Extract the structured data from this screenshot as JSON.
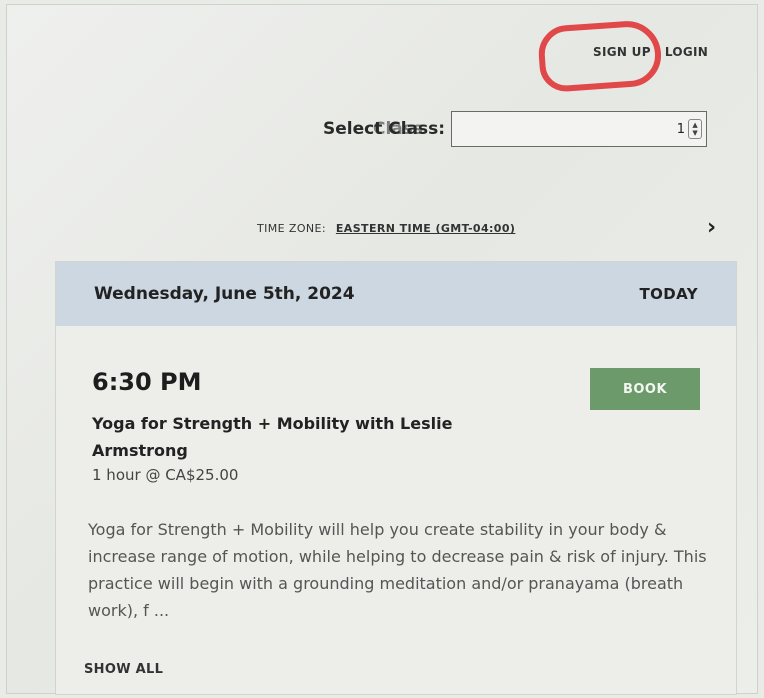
{
  "nav": {
    "signup_label": "SIGN UP",
    "login_label": "LOGIN"
  },
  "class_select": {
    "label": "Select Class:",
    "ghost_text": "Class",
    "value": "1"
  },
  "timezone": {
    "label": "TIME ZONE:",
    "value": "EASTERN TIME (GMT-04:00)",
    "next_icon": "chevron-right-icon"
  },
  "schedule": {
    "date": "Wednesday, June 5th, 2024",
    "today_label": "TODAY",
    "class": {
      "time": "6:30 PM",
      "book_label": "BOOK",
      "name": "Yoga for Strength + Mobility with Leslie Armstrong",
      "meta": "1 hour @ CA$25.00",
      "description": "Yoga for Strength + Mobility will help you create stability in your body & increase range of motion, while helping to decrease pain & risk of injury. This practice will begin with a grounding meditation and/or pranayama (breath work), f ..."
    },
    "show_all_label": "SHOW ALL"
  },
  "colors": {
    "book_button": "#6d9a6b",
    "day_header": "#cdd7e1",
    "annotation_circle": "#e0484a"
  }
}
